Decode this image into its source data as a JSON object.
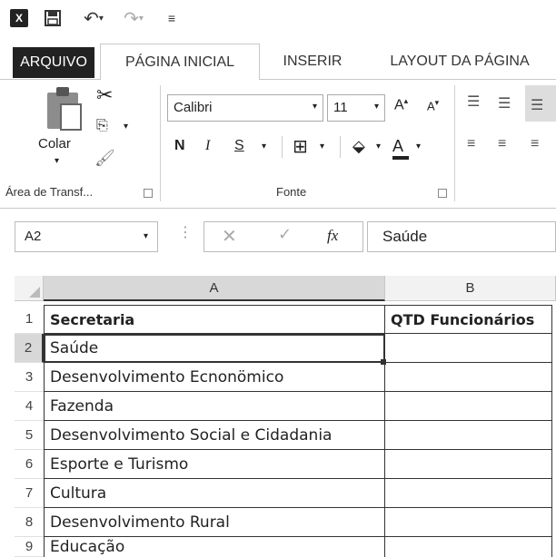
{
  "qat": {
    "app_icon": "excel-icon",
    "app_letter": "X",
    "save_icon": "save-icon",
    "undo_icon": "undo-icon",
    "redo_icon": "redo-icon"
  },
  "tabs": [
    {
      "label": "ARQUIVO"
    },
    {
      "label": "PÁGINA INICIAL"
    },
    {
      "label": "INSERIR"
    },
    {
      "label": "LAYOUT DA PÁGINA"
    }
  ],
  "ribbon": {
    "clipboard": {
      "paste_label": "Colar",
      "group_label": "Área de Transf..."
    },
    "font": {
      "family": "Calibri",
      "size": "11",
      "bold": "N",
      "italic": "I",
      "underline": "S",
      "font_color_letter": "A",
      "grow_label": "A",
      "shrink_label": "A",
      "group_label": "Fonte"
    }
  },
  "formula_bar": {
    "name_box": "A2",
    "fx_label": "fx",
    "value": "Saúde"
  },
  "sheet": {
    "columns": [
      "A",
      "B"
    ],
    "rows": [
      {
        "num": "1",
        "a": "Secretaria",
        "b": "QTD Funcionários"
      },
      {
        "num": "2",
        "a": "Saúde",
        "b": ""
      },
      {
        "num": "3",
        "a": "Desenvolvimento Ecnonömico",
        "b": ""
      },
      {
        "num": "4",
        "a": "Fazenda",
        "b": ""
      },
      {
        "num": "5",
        "a": "Desenvolvimento Social e Cidadania",
        "b": ""
      },
      {
        "num": "6",
        "a": "Esporte e Turismo",
        "b": ""
      },
      {
        "num": "7",
        "a": "Cultura",
        "b": ""
      },
      {
        "num": "8",
        "a": "Desenvolvimento Rural",
        "b": ""
      },
      {
        "num": "9",
        "a": "Educação",
        "b": ""
      }
    ],
    "active_cell": "A2"
  }
}
